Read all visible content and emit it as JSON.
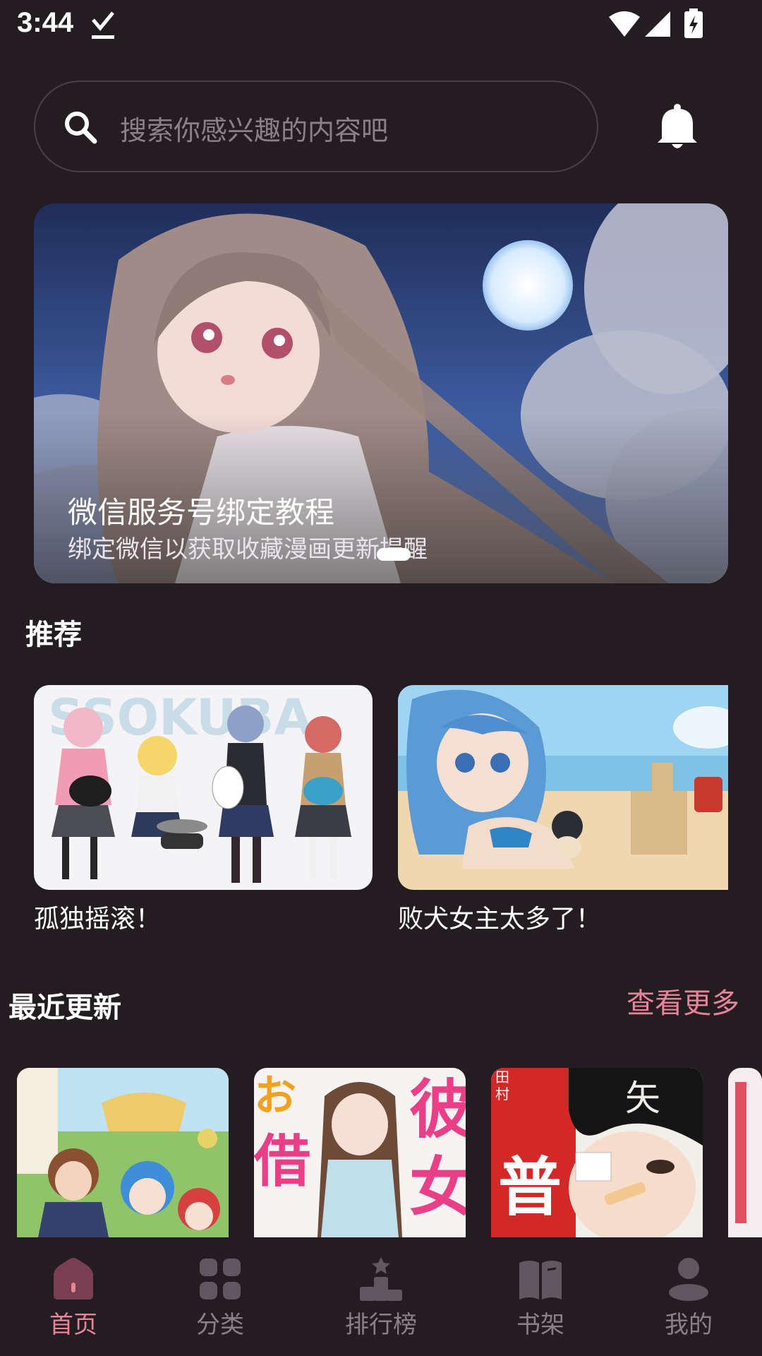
{
  "status_bar": {
    "time": "3:44",
    "icons": [
      "download-done-icon",
      "wifi-icon",
      "signal-icon",
      "battery-charging-icon"
    ]
  },
  "search": {
    "placeholder": "搜索你感兴趣的内容吧",
    "icon": "search-icon",
    "notification_icon": "bell-icon"
  },
  "banner": {
    "title": "微信服务号绑定教程",
    "subtitle": "绑定微信以获取收藏漫画更新提醒",
    "image": "anime-girl-moonlit-sky"
  },
  "recommend": {
    "title": "推荐",
    "items": [
      {
        "title": "孤独摇滚！",
        "image": "band-girls-cover"
      },
      {
        "title": "败犬女主太多了！",
        "image": "beach-girl-cover"
      }
    ]
  },
  "recent": {
    "title": "最近更新",
    "more": "查看更多",
    "items": [
      {
        "image": "fantasy-adventure-cover"
      },
      {
        "image": "girlfriend-cover"
      },
      {
        "image": "yano-kun-cover"
      },
      {
        "image": "partial-cover"
      }
    ]
  },
  "nav": {
    "active_color": "#e8839a",
    "items": [
      {
        "label": "首页",
        "icon": "home-icon",
        "active": true
      },
      {
        "label": "分类",
        "icon": "grid-icon",
        "active": false
      },
      {
        "label": "排行榜",
        "icon": "ranking-icon",
        "active": false
      },
      {
        "label": "书架",
        "icon": "book-icon",
        "active": false
      },
      {
        "label": "我的",
        "icon": "person-icon",
        "active": false
      }
    ]
  }
}
